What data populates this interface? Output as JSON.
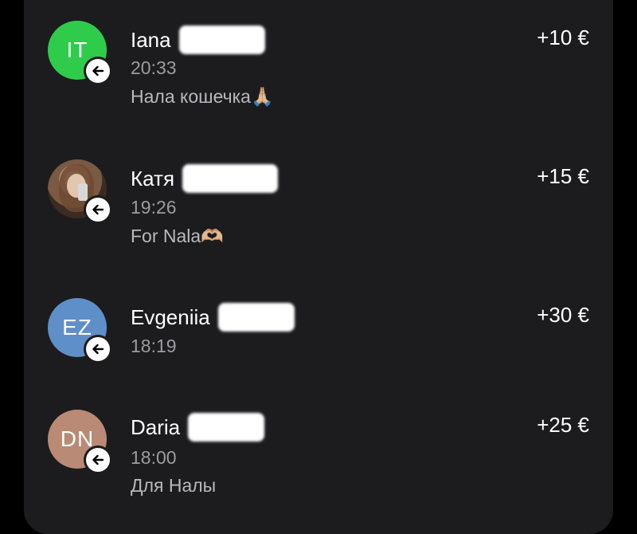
{
  "transactions": [
    {
      "initials": "IT",
      "avatar_color": "#2ecc4a",
      "name": "Iana",
      "time": "20:33",
      "note": "Нала кошечка🙏🏼",
      "amount": "+10 €",
      "direction_icon": "arrow-left-icon"
    },
    {
      "initials": "",
      "avatar_color": "photo",
      "name": "Катя",
      "time": "19:26",
      "note": "For Nala🫶🏼",
      "amount": "+15 €",
      "direction_icon": "arrow-left-icon"
    },
    {
      "initials": "EZ",
      "avatar_color": "#5f8fc9",
      "name": "Evgeniia",
      "time": "18:19",
      "note": "",
      "amount": "+30 €",
      "direction_icon": "arrow-left-icon"
    },
    {
      "initials": "DN",
      "avatar_color": "#b98a75",
      "name": "Daria",
      "time": "18:00",
      "note": "Для Налы",
      "amount": "+25 €",
      "direction_icon": "arrow-left-icon"
    }
  ]
}
